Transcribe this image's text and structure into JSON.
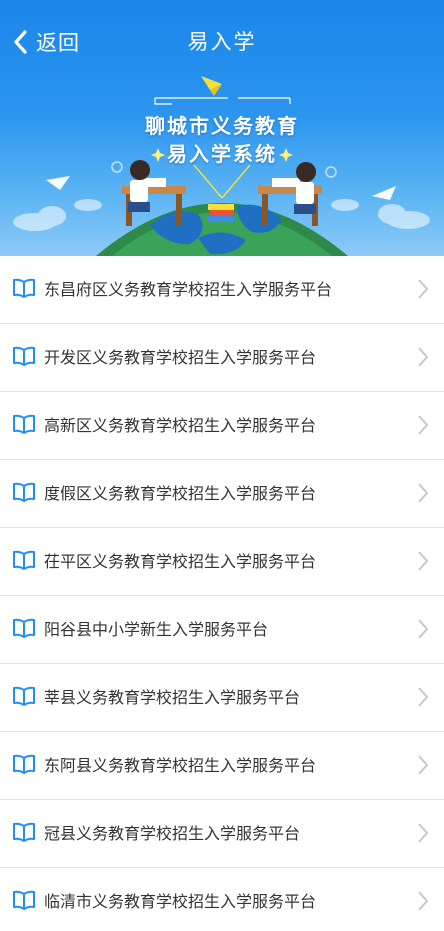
{
  "header": {
    "back_label": "返回",
    "title": "易入学"
  },
  "banner": {
    "line1": "聊城市义务教育",
    "line2": "易入学系统"
  },
  "colors": {
    "accent": "#1a86ea",
    "icon_blue": "#1f8ff0",
    "text": "#333333",
    "chevron": "#c7c7c7"
  },
  "list": {
    "items": [
      {
        "label": "东昌府区义务教育学校招生入学服务平台",
        "icon": "book-icon"
      },
      {
        "label": "开发区义务教育学校招生入学服务平台",
        "icon": "book-icon"
      },
      {
        "label": "高新区义务教育学校招生入学服务平台",
        "icon": "book-icon"
      },
      {
        "label": "度假区义务教育学校招生入学服务平台",
        "icon": "book-icon"
      },
      {
        "label": "茌平区义务教育学校招生入学服务平台",
        "icon": "book-icon"
      },
      {
        "label": "阳谷县中小学新生入学服务平台",
        "icon": "book-icon"
      },
      {
        "label": "莘县义务教育学校招生入学服务平台",
        "icon": "book-icon"
      },
      {
        "label": "东阿县义务教育学校招生入学服务平台",
        "icon": "book-icon"
      },
      {
        "label": "冠县义务教育学校招生入学服务平台",
        "icon": "book-icon"
      },
      {
        "label": "临清市义务教育学校招生入学服务平台",
        "icon": "book-icon"
      }
    ]
  }
}
